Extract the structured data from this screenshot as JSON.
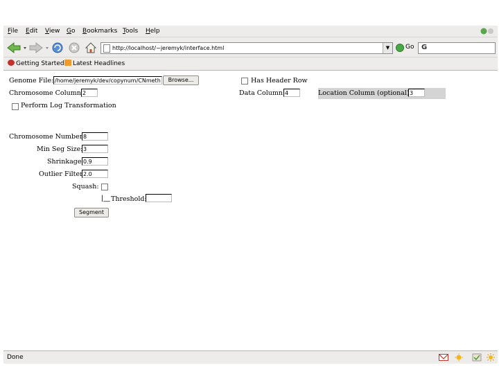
{
  "menu": [
    "File",
    "Edit",
    "View",
    "Go",
    "Bookmarks",
    "Tools",
    "Help"
  ],
  "toolbar": {
    "url": "http://localhost/~jeremyk/interface.html",
    "go_label": "Go",
    "search_value": ""
  },
  "bookmarks": [
    "Getting Started",
    "Latest Headlines"
  ],
  "form": {
    "genome_file_label": "Genome File:",
    "genome_file_value": "/home/jeremyk/dev/copynum/CNmeth",
    "browse_label": "Browse...",
    "has_header_label": "Has Header Row",
    "has_header_checked": false,
    "chrom_col_label": "Chromosome Column:",
    "chrom_col_value": "2",
    "data_col_label": "Data Column:",
    "data_col_value": "4",
    "loc_col_label": "Location Column (optional):",
    "loc_col_value": "3",
    "log_transform_label": "Perform Log Transformation",
    "log_transform_checked": false,
    "chrom_num_label": "Chromosome Number:",
    "chrom_num_value": "8",
    "min_seg_label": "Min Seg Size:",
    "min_seg_value": "3",
    "shrinkage_label": "Shrinkage:",
    "shrinkage_value": "0.9",
    "outlier_label": "Outlier Filter:",
    "outlier_value": "2.0",
    "squash_label": "Squash:",
    "squash_checked": false,
    "threshold_label": "Threshold:",
    "threshold_value": "",
    "segment_label": "Segment"
  },
  "status": {
    "text": "Done",
    "icons": [
      "mail-icon",
      "weather-icon",
      "check-icon",
      "sun-icon"
    ]
  },
  "colors": {
    "chrome_bg": "#edecea",
    "location_highlight": "#d4d4d4",
    "go_green": "#4aa847"
  }
}
